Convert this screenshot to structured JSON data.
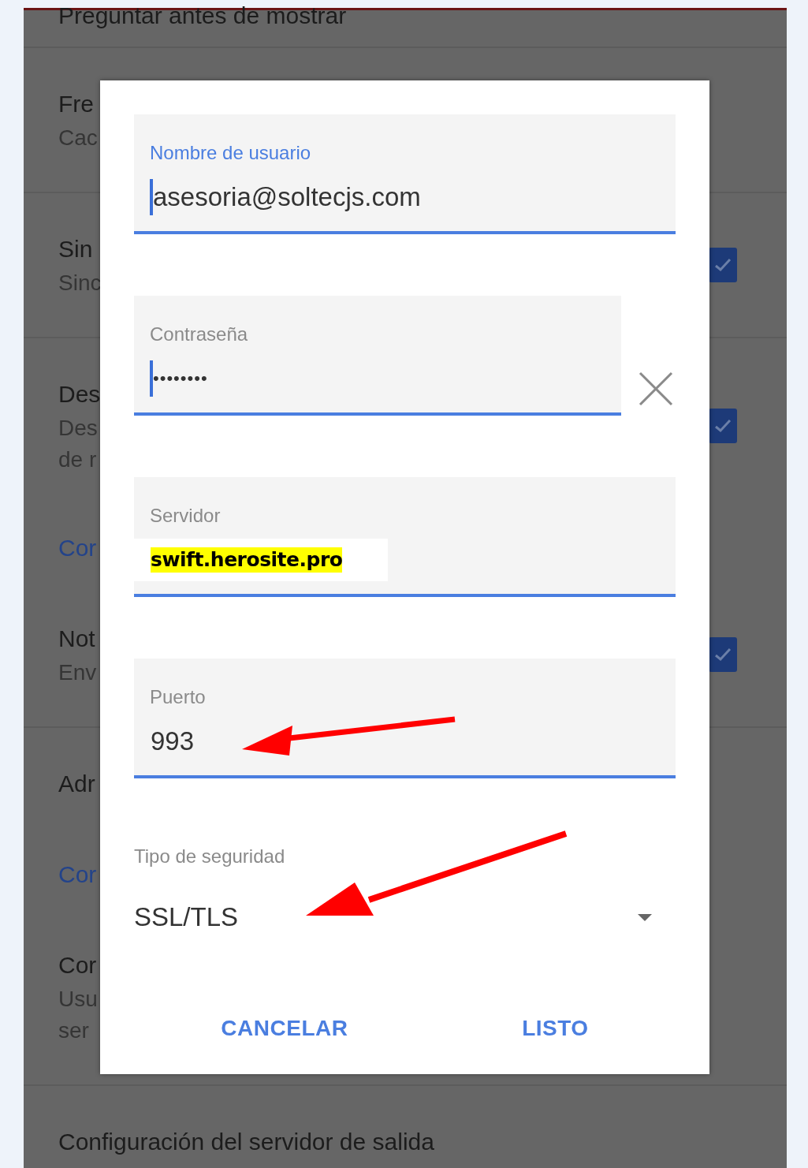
{
  "background": {
    "sections": [
      {
        "rows": [
          {
            "kind": "setting",
            "title": "Preguntar antes de mostrar"
          }
        ]
      },
      {
        "rows": [
          {
            "kind": "setting",
            "title": "Fre",
            "subtitles": [
              "Cac"
            ]
          }
        ]
      },
      {
        "rows": [
          {
            "kind": "setting",
            "title": "Sin",
            "subtitles": [
              "Sinc"
            ],
            "checked": true
          }
        ]
      },
      {
        "rows": [
          {
            "kind": "setting",
            "title": "Des",
            "subtitles": [
              "Des",
              "de r"
            ],
            "checked": true
          },
          {
            "kind": "header",
            "title": "Cor"
          },
          {
            "kind": "setting",
            "title": "Not",
            "subtitles": [
              "Env"
            ],
            "checked": true
          }
        ]
      },
      {
        "rows": [
          {
            "kind": "setting",
            "title": "Adr"
          },
          {
            "kind": "header",
            "title": "Cor"
          },
          {
            "kind": "setting",
            "title": "Cor",
            "subtitles": [
              "Usu",
              "ser"
            ]
          }
        ]
      },
      {
        "rows": [
          {
            "kind": "setting",
            "title": "Configuración del servidor de salida"
          }
        ]
      }
    ]
  },
  "dialog": {
    "fields": [
      {
        "kind": "text",
        "label": "Nombre de usuario",
        "value": "asesoria@soltecjs.com",
        "focused": true,
        "caret": true
      },
      {
        "kind": "password",
        "label": "Contraseña",
        "value": "••••••••",
        "focused": false,
        "caret": true
      },
      {
        "kind": "text",
        "label": "Servidor",
        "value": "swift.herosite.pro",
        "focused": false,
        "highlighted": true
      },
      {
        "kind": "text",
        "label": "Puerto",
        "value": "993",
        "focused": false
      }
    ],
    "select": {
      "label": "Tipo de seguridad",
      "value": "SSL/TLS"
    },
    "buttons": [
      "CANCELAR",
      "LISTO"
    ]
  }
}
